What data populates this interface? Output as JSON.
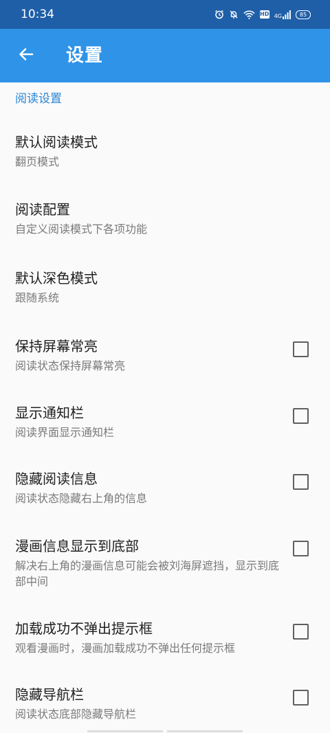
{
  "status_bar": {
    "time": "10:34",
    "hd_label": "HD",
    "network_label": "4G",
    "battery": "85"
  },
  "app_bar": {
    "title": "设置"
  },
  "section": {
    "title": "阅读设置"
  },
  "settings": [
    {
      "title": "默认阅读模式",
      "subtitle": "翻页模式"
    },
    {
      "title": "阅读配置",
      "subtitle": "自定义阅读模式下各项功能"
    },
    {
      "title": "默认深色模式",
      "subtitle": "跟随系统"
    },
    {
      "title": "保持屏幕常亮",
      "subtitle": "阅读状态保持屏幕常亮",
      "checked": false
    },
    {
      "title": "显示通知栏",
      "subtitle": "阅读界面显示通知栏",
      "checked": false
    },
    {
      "title": "隐藏阅读信息",
      "subtitle": "阅读状态隐藏右上角的信息",
      "checked": false
    },
    {
      "title": "漫画信息显示到底部",
      "subtitle": "解决右上角的漫画信息可能会被刘海屏遮挡，显示到底部中间",
      "checked": false
    },
    {
      "title": "加载成功不弹出提示框",
      "subtitle": "观看漫画时，漫画加载成功不弹出任何提示框",
      "checked": false
    },
    {
      "title": "隐藏导航栏",
      "subtitle": "阅读状态底部隐藏导航栏",
      "checked": false
    }
  ]
}
